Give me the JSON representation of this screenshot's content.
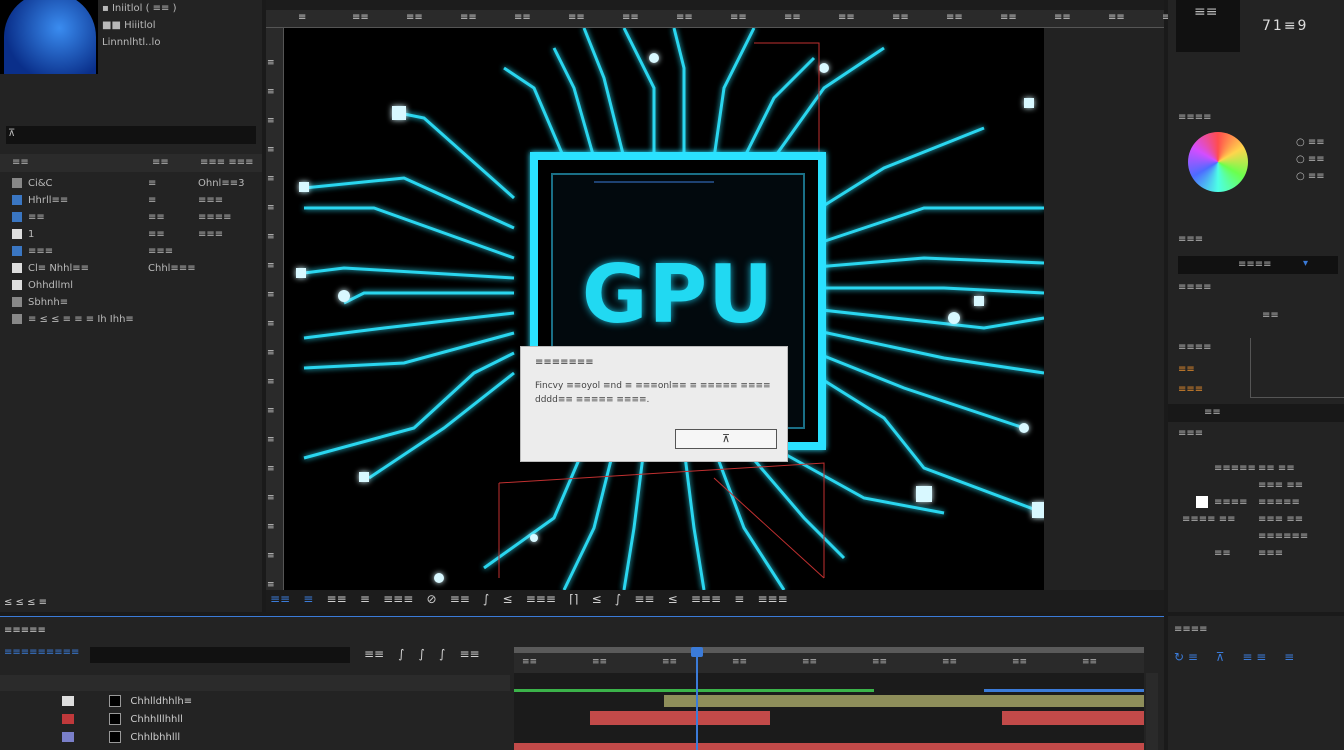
{
  "project_panel": {
    "thumb_info": [
      "▪ Iniitlol ( ≡≡ )",
      "■■ Hiiitlol",
      "Linnnlhtl..lo"
    ],
    "search_value": "",
    "search_label": "⊼",
    "headers": [
      "≡≡",
      "≡≡",
      "≡≡≡ ≡≡≡"
    ],
    "items": [
      {
        "name": "Ci&C",
        "col2": "≡",
        "col3": "Ohnl≡≡3",
        "icon": "#888"
      },
      {
        "name": "Hhrll≡≡",
        "col2": "≡",
        "col3": "≡≡≡",
        "icon": "#3a76c2"
      },
      {
        "name": "≡≡",
        "col2": "≡≡",
        "col3": "≡≡≡≡",
        "icon": "#3a76c2"
      },
      {
        "name": "1",
        "col2": "≡≡",
        "col3": "≡≡≡",
        "icon": "#ddd"
      },
      {
        "name": "≡≡≡",
        "col2": "≡≡≡",
        "col3": "",
        "icon": "#3a76c2"
      },
      {
        "name": "Cl≡ Nhhl≡≡",
        "col2": "Chhl≡≡≡",
        "col3": "",
        "icon": "#ddd"
      },
      {
        "name": "Ohhdllml",
        "col2": "",
        "col3": "",
        "icon": "#ddd"
      },
      {
        "name": "Sbhnh≡",
        "col2": "",
        "col3": "",
        "icon": "#888"
      },
      {
        "name": "≡ ≤ ≤ ≡ ≡ ≡ Ih Ihh≡",
        "col2": "",
        "col3": "",
        "icon": "#888"
      }
    ],
    "footer": "≤  ≤  ≤  ≡"
  },
  "viewer": {
    "ruler_labels": [
      "≡",
      "≡≡",
      "≡≡",
      "≡≡",
      "≡≡",
      "≡≡",
      "≡≡",
      "≡≡",
      "≡≡",
      "≡≡",
      "≡≡",
      "≡≡",
      "≡≡",
      "≡≡",
      "≡≡",
      "≡≡",
      "≡≡"
    ],
    "vruler_labels": [
      "≡",
      "≡",
      "≡",
      "≡",
      "≡",
      "≡",
      "≡",
      "≡",
      "≡",
      "≡",
      "≡",
      "≡",
      "≡",
      "≡",
      "≡",
      "≡",
      "≡",
      "≡",
      "≡"
    ],
    "chip_text": "GPU",
    "dialog": {
      "title": "≡≡≡≡≡≡≡",
      "message": "Fincvy ≡≡oyol ≡nd ≡ ≡≡≡onl≡≡ ≡ ≡≡≡≡≡ ≡≡≡≡ dddd≡≡ ≡≡≡≡≡ ≡≡≡≡.",
      "ok_label": "⊼"
    },
    "toolbar": [
      "≡≡",
      "≡",
      "≡≡",
      "≡",
      "≡≡≡",
      "⊘",
      "≡≡",
      "∫",
      "≤",
      "≡≡≡",
      "⌈⌉",
      "≤",
      "∫",
      "≡≡",
      "≤",
      "≡≡≡",
      "≡",
      "≡≡≡"
    ]
  },
  "right_panel": {
    "readout": "71≡9",
    "readout_icon_label": "≡≡",
    "color_title": "≡≡≡≡",
    "color_values": [
      "○ ≡≡",
      "○ ≡≡",
      "○ ≡≡"
    ],
    "section1_title": "≡≡≡",
    "dropdown_value": "≡≡≡≡",
    "section2_title": "≡≡≡≡",
    "center_label": "≡≡",
    "param_title": "≡≡≡≡",
    "param_orange1": "≡≡",
    "param_orange2": "≡≡≡",
    "tab_label": "≡≡",
    "props_title": "≡≡≡",
    "props_rows": [
      [
        "≡≡≡≡≡",
        "≡≡ ≡≡"
      ],
      [
        "",
        "≡≡≡ ≡≡"
      ],
      [
        "≡≡≡≡",
        "≡≡≡≡≡"
      ],
      [
        "≡≡≡≡ ≡≡",
        "≡≡≡ ≡≡"
      ],
      [
        "",
        "≡≡≡≡≡≡"
      ],
      [
        "≡≡",
        "≡≡≡"
      ]
    ],
    "bottom_title": "≡≡≡≡",
    "bottom_icons": [
      "↻ ≡",
      "⊼",
      "≡ ≡",
      "≡"
    ]
  },
  "timeline": {
    "title": "≡≡≡≡≡",
    "timecode": "≡≡≡≡≡≡≡≡≡",
    "search_value": "",
    "tools": [
      "≡≡",
      "∫",
      "∫",
      "∫",
      "≡≡"
    ],
    "ruler": [
      "≡≡",
      "≡≡",
      "≡≡",
      "≡≡",
      "≡≡",
      "≡≡",
      "≡≡",
      "≡≡",
      "≡≡"
    ],
    "layers": [
      {
        "name": "Chhlldhhlh≡",
        "color": "#dddddd"
      },
      {
        "name": "Chhhlllhhll",
        "color": "#c0393b"
      },
      {
        "name": "Chhlbhhlll",
        "color": "#7a7fc9"
      }
    ]
  }
}
